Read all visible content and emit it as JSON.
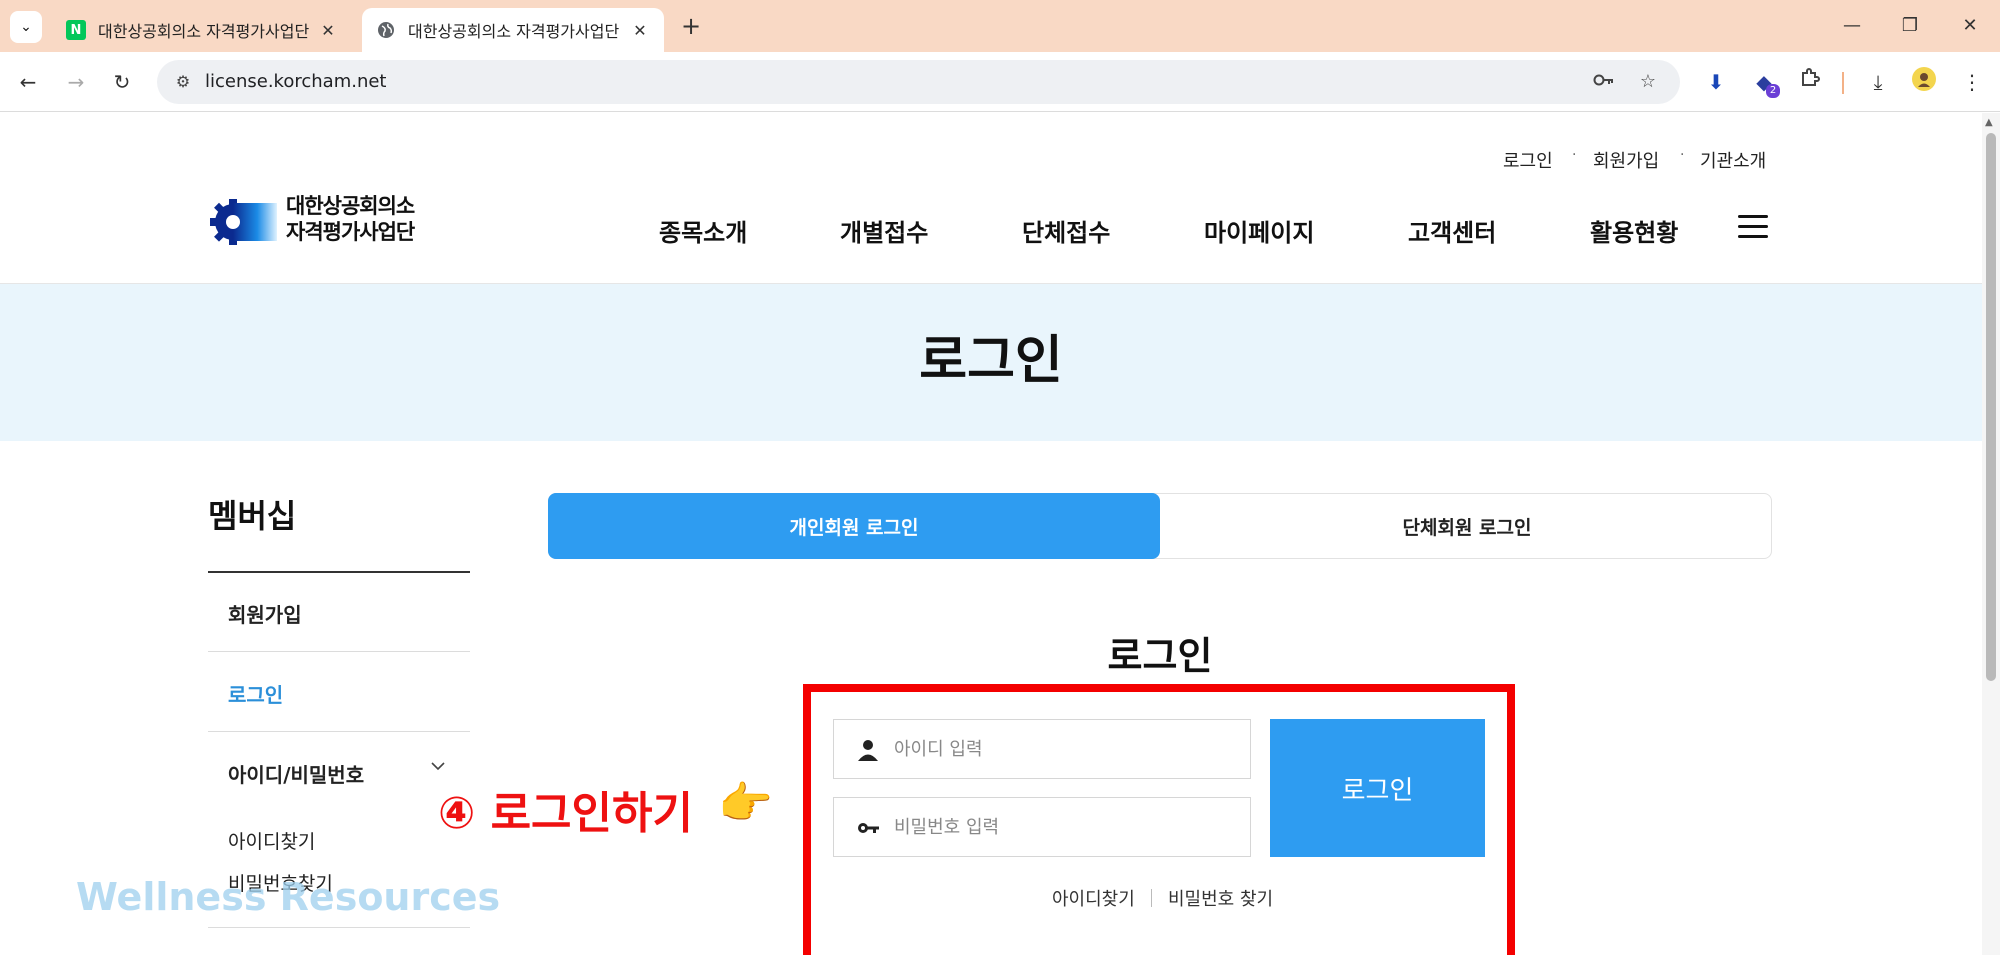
{
  "browser": {
    "tabs": [
      {
        "title": "대한상공회의소 자격평가사업단",
        "favicon": "naver-n-icon",
        "favicon_text": "N",
        "active": false
      },
      {
        "title": "대한상공회의소 자격평가사업단",
        "favicon": "globe-icon",
        "active": true
      }
    ],
    "new_tab": "+",
    "url": "license.korcham.net",
    "window_controls": {
      "minimize": "—",
      "restore": "❐",
      "close": "✕"
    }
  },
  "site": {
    "util_links": [
      "로그인",
      "회원가입",
      "기관소개"
    ],
    "logo_line1": "대한상공회의소",
    "logo_line2": "자격평가사업단",
    "nav": [
      "종목소개",
      "개별접수",
      "단체접수",
      "마이페이지",
      "고객센터",
      "활용현황"
    ],
    "hero_title": "로그인"
  },
  "sidebar": {
    "title": "멤버십",
    "items": [
      {
        "label": "회원가입",
        "active": false
      },
      {
        "label": "로그인",
        "active": true
      },
      {
        "label": "아이디/비밀번호",
        "active": false,
        "expanded": true
      }
    ],
    "subitems": [
      "아이디찾기",
      "비밀번호찾기"
    ]
  },
  "login": {
    "tab_personal": "개인회원 로그인",
    "tab_group": "단체회원 로그인",
    "heading": "로그인",
    "id_placeholder": "아이디 입력",
    "pw_placeholder": "비밀번호 입력",
    "button": "로그인",
    "find_id": "아이디찾기",
    "find_pw": "비밀번호 찾기"
  },
  "annotation": {
    "callout": "④ 로그인하기",
    "hand": "👉",
    "watermark": "Wellness Resources"
  },
  "colors": {
    "accent": "#2e9cf1",
    "hero_bg": "#e9f5fc",
    "highlight_box": "#f40000",
    "tabbar": "#f9d9c5",
    "active_side": "#2b8fd9"
  }
}
